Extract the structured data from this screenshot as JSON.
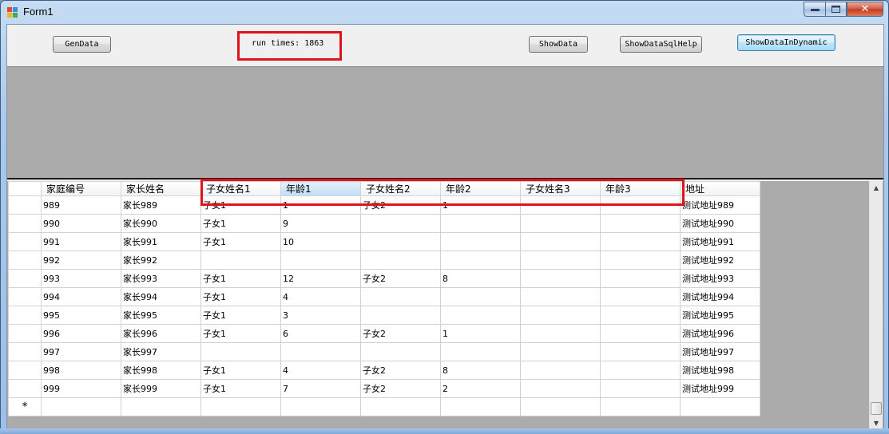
{
  "window": {
    "title": "Form1",
    "close_glyph": "✕"
  },
  "toolbar": {
    "gendata_label": "GenData",
    "run_times": "run times: 1863",
    "showdata_label": "ShowData",
    "showdata_sqlhelp_label": "ShowDataSqlHelp",
    "showdata_dynamic_label": "ShowDataInDynamic"
  },
  "grid": {
    "columns": [
      "家庭编号",
      "家长姓名",
      "子女姓名1",
      "年龄1",
      "子女姓名2",
      "年龄2",
      "子女姓名3",
      "年龄3",
      "地址"
    ],
    "selected_column": 3,
    "rows": [
      [
        "989",
        "家长989",
        "子女1",
        "1",
        "子女2",
        "1",
        "",
        "",
        "测试地址989"
      ],
      [
        "990",
        "家长990",
        "子女1",
        "9",
        "",
        "",
        "",
        "",
        "测试地址990"
      ],
      [
        "991",
        "家长991",
        "子女1",
        "10",
        "",
        "",
        "",
        "",
        "测试地址991"
      ],
      [
        "992",
        "家长992",
        "",
        "",
        "",
        "",
        "",
        "",
        "测试地址992"
      ],
      [
        "993",
        "家长993",
        "子女1",
        "12",
        "子女2",
        "8",
        "",
        "",
        "测试地址993"
      ],
      [
        "994",
        "家长994",
        "子女1",
        "4",
        "",
        "",
        "",
        "",
        "测试地址994"
      ],
      [
        "995",
        "家长995",
        "子女1",
        "3",
        "",
        "",
        "",
        "",
        "测试地址995"
      ],
      [
        "996",
        "家长996",
        "子女1",
        "6",
        "子女2",
        "1",
        "",
        "",
        "测试地址996"
      ],
      [
        "997",
        "家长997",
        "",
        "",
        "",
        "",
        "",
        "",
        "测试地址997"
      ],
      [
        "998",
        "家长998",
        "子女1",
        "4",
        "子女2",
        "8",
        "",
        "",
        "测试地址998"
      ],
      [
        "999",
        "家长999",
        "子女1",
        "7",
        "子女2",
        "2",
        "",
        "",
        "测试地址999"
      ]
    ],
    "new_row_marker": "*"
  },
  "colors": {
    "highlight_box": "#e0121b",
    "panel_gray": "#ababab"
  }
}
